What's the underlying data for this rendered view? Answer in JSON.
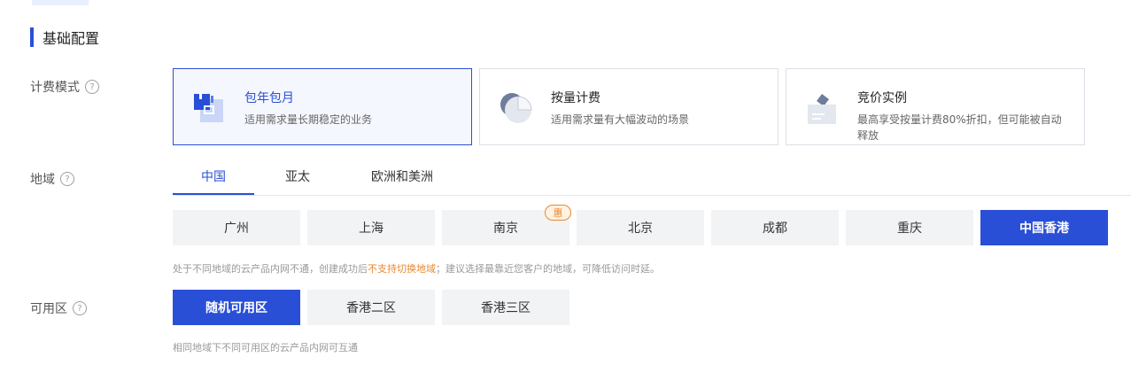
{
  "section": {
    "title": "基础配置"
  },
  "billing": {
    "label": "计费模式",
    "help": "?",
    "options": [
      {
        "title": "包年包月",
        "desc": "适用需求量长期稳定的业务",
        "icon": "calendar-icon",
        "selected": true
      },
      {
        "title": "按量计费",
        "desc": "适用需求量有大幅波动的场景",
        "icon": "pie-chart-icon",
        "selected": false
      },
      {
        "title": "竞价实例",
        "desc": "最高享受按量计费80%折扣，但可能被自动释放",
        "icon": "bid-icon",
        "selected": false
      }
    ]
  },
  "region": {
    "label": "地域",
    "help": "?",
    "tabs": [
      "中国",
      "亚太",
      "欧洲和美洲"
    ],
    "active_tab": "中国",
    "options": [
      "广州",
      "上海",
      "南京",
      "北京",
      "成都",
      "重庆",
      "中国香港"
    ],
    "selected": "中国香港",
    "promo_badge": "惠",
    "hint_prefix": "处于不同地域的云产品内网不通，创建成功后",
    "hint_warn": "不支持切换地域",
    "hint_suffix": "；建议选择最靠近您客户的地域，可降低访问时延。"
  },
  "zone": {
    "label": "可用区",
    "help": "?",
    "options": [
      "随机可用区",
      "香港二区",
      "香港三区"
    ],
    "selected": "随机可用区",
    "hint": "相同地域下不同可用区的云产品内网可互通"
  },
  "colors": {
    "accent": "#2a4fd7",
    "warn": "#e8892f"
  }
}
